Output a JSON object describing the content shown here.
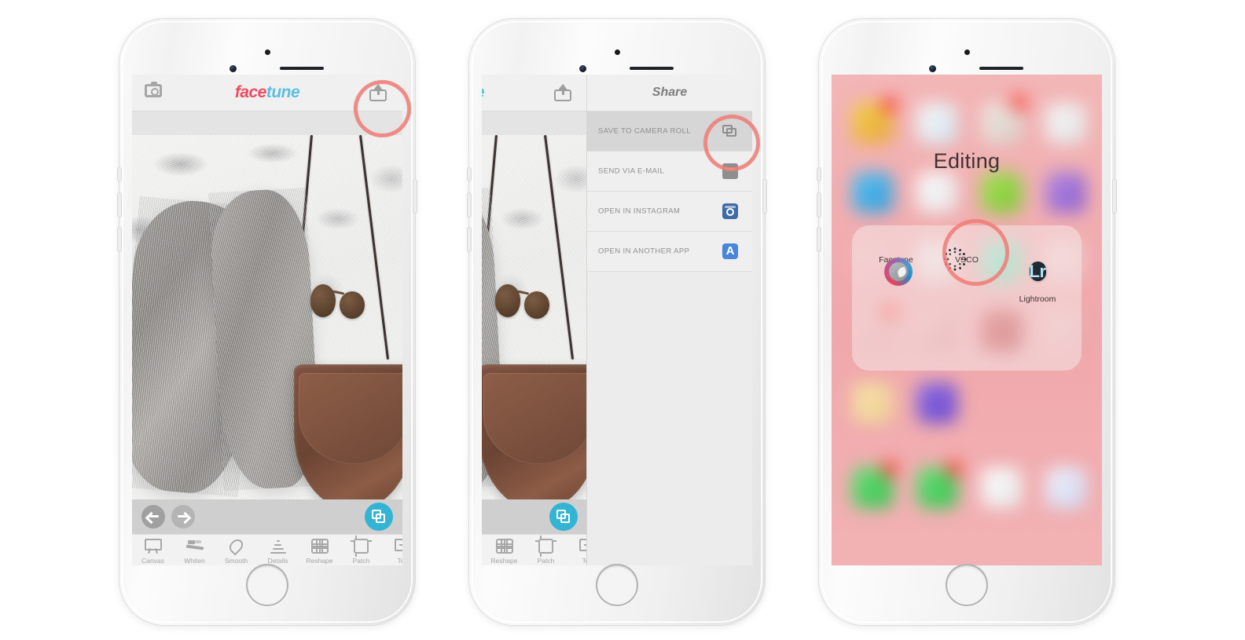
{
  "phones": {
    "phone1": {
      "label": "facetune-editor-screen",
      "app": {
        "logo_part1": "face",
        "logo_part2": "tune",
        "camera_icon": "camera-icon",
        "share_icon": "share-icon"
      },
      "controls": {
        "undo": "undo-arrow-icon",
        "redo": "redo-arrow-icon",
        "save": "save-copy-icon"
      },
      "tools": [
        {
          "label": "Canvas",
          "icon": "canvas-icon"
        },
        {
          "label": "Whiten",
          "icon": "whiten-icon"
        },
        {
          "label": "Smooth",
          "icon": "smooth-icon"
        },
        {
          "label": "Details",
          "icon": "details-icon"
        },
        {
          "label": "Reshape",
          "icon": "reshape-icon"
        },
        {
          "label": "Patch",
          "icon": "patch-icon"
        },
        {
          "label": "Ton",
          "icon": "tone-icon"
        }
      ],
      "annotation": "circled-share-button"
    },
    "phone2": {
      "label": "facetune-share-menu-screen",
      "app": {
        "logo_part2": "e",
        "share_icon": "share-icon"
      },
      "share": {
        "title": "Share",
        "items": [
          {
            "label": "SAVE TO CAMERA ROLL",
            "icon": "camera-roll-icon",
            "selected": true
          },
          {
            "label": "SEND VIA E-MAIL",
            "icon": "mail-icon",
            "selected": false
          },
          {
            "label": "OPEN IN INSTAGRAM",
            "icon": "instagram-icon",
            "selected": false
          },
          {
            "label": "OPEN IN ANOTHER APP",
            "icon": "app-store-icon",
            "selected": false
          }
        ]
      },
      "tools": [
        {
          "label": "Reshape",
          "icon": "reshape-icon"
        },
        {
          "label": "Patch",
          "icon": "patch-icon"
        },
        {
          "label": "Ton",
          "icon": "tone-icon"
        }
      ],
      "annotation": "circled-save-to-camera-roll"
    },
    "phone3": {
      "label": "ios-home-screen-folder",
      "folder": {
        "title": "Editing",
        "apps": [
          {
            "name": "Facetune",
            "icon": "facetune-app-icon"
          },
          {
            "name": "VSCO",
            "icon": "vsco-app-icon"
          },
          {
            "name": "Lightroom",
            "icon": "lightroom-app-icon"
          }
        ]
      },
      "annotation": "circled-vsco-app"
    }
  },
  "colors": {
    "accent_coral": "#ef7f78",
    "facetune_red": "#ef4b63",
    "facetune_blue": "#5bc0e0",
    "save_button_blue": "#34b4d4",
    "instagram_blue": "#3e6aa6",
    "appstore_blue": "#4a86d8",
    "lightroom_dark": "#202a33",
    "wallpaper_pink": "#f0a8ac"
  },
  "appstore_glyph": "A"
}
